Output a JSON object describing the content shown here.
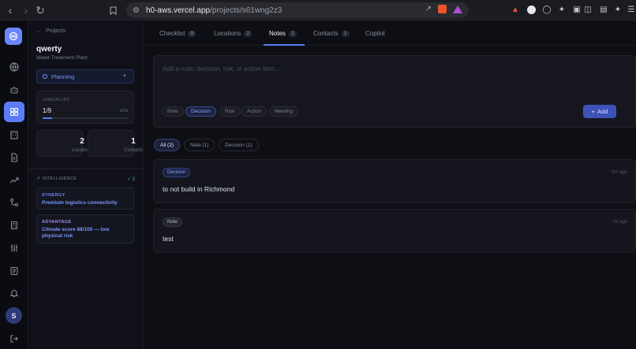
{
  "browser": {
    "url_domain": "h0-aws.vercel.app",
    "url_path": "/projects/s61wng2z3"
  },
  "rail": {
    "avatar_initial": "S"
  },
  "sidebar": {
    "back_label": "Projects",
    "project_name": "qwerty",
    "project_type": "Water Treatment Plant",
    "status": "Planning",
    "checklist": {
      "label": "CHECKLIST",
      "value": "1/9",
      "percent": "11%",
      "progress": 0.11
    },
    "locations": {
      "count": "2",
      "label": "Locations"
    },
    "contacts": {
      "count": "1",
      "label": "Contacts"
    },
    "intelligence": {
      "label": "INTELLIGENCE",
      "count": "✓ 2",
      "items": [
        {
          "kind": "SYNERGY",
          "text": "Premium logistics connectivity"
        },
        {
          "kind": "ADVANTAGE",
          "text": "Climate score 88/100 — low physical risk"
        }
      ]
    }
  },
  "tabs": [
    {
      "label": "Checklist",
      "count": "9"
    },
    {
      "label": "Locations",
      "count": "2"
    },
    {
      "label": "Notes",
      "count": "2"
    },
    {
      "label": "Contacts",
      "count": "1"
    },
    {
      "label": "Copilot",
      "count": ""
    }
  ],
  "composer": {
    "placeholder": "Add a note, decision, risk, or action item...",
    "types": [
      "Note",
      "Decision",
      "Risk",
      "Action",
      "Meeting"
    ],
    "selected_type": "Decision",
    "add_label": "Add"
  },
  "filters": [
    "All (2)",
    "Note (1)",
    "Decision (1)"
  ],
  "notes": [
    {
      "type": "Decision",
      "time": "0m ago",
      "text": "to not build in Richmond"
    },
    {
      "type": "Note",
      "time": "2d ago",
      "text": "test"
    }
  ],
  "colors": {
    "accent": "#5b7cf7",
    "background": "#0e0f15",
    "panel": "#16171e"
  }
}
